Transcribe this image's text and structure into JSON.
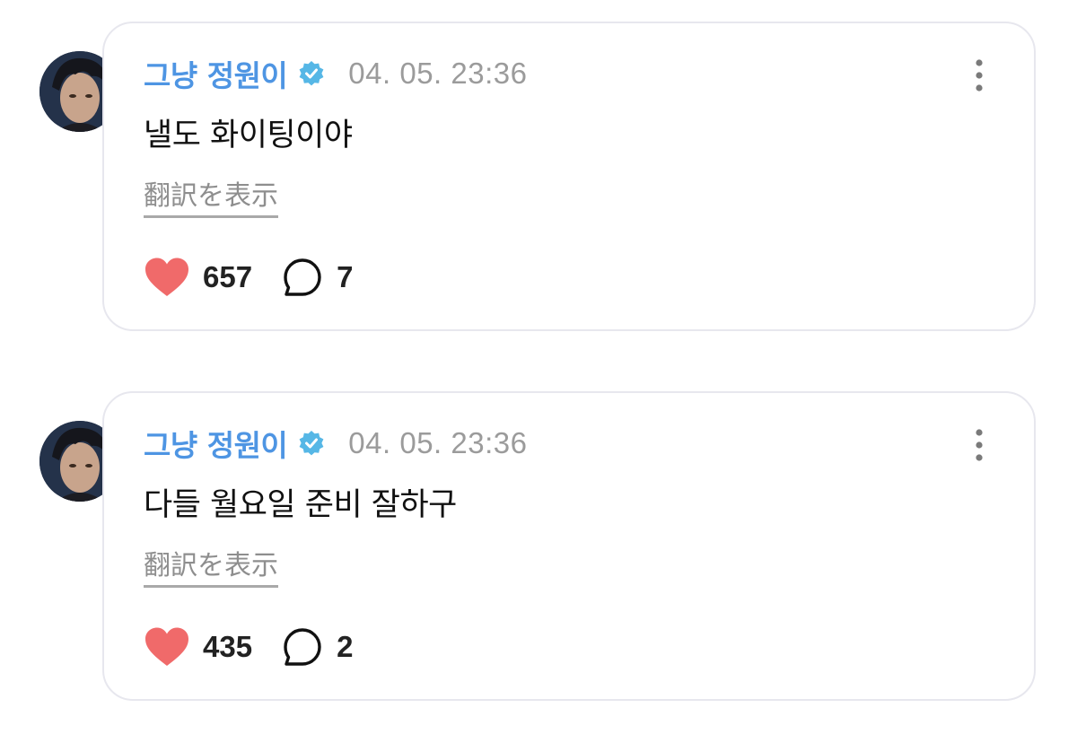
{
  "posts": [
    {
      "author": "그냥 정원이",
      "timestamp": "04. 05. 23:36",
      "text": "낼도 화이팅이야",
      "translate_label": "翻訳を表示",
      "likes": "657",
      "replies": "7"
    },
    {
      "author": "그냥 정원이",
      "timestamp": "04. 05. 23:36",
      "text": "다들 월요일 준비 잘하구",
      "translate_label": "翻訳を表示",
      "likes": "435",
      "replies": "2"
    }
  ],
  "icons": {
    "verified": "verified-badge-icon",
    "more": "more-vertical-icon",
    "like": "heart-icon",
    "reply": "speech-bubble-icon"
  },
  "colors": {
    "author": "#4e95e3",
    "verified_badge": "#56b7e6",
    "heart": "#f06a6a",
    "timestamp": "#9b9b9b",
    "card_border": "#e7e7ee"
  }
}
